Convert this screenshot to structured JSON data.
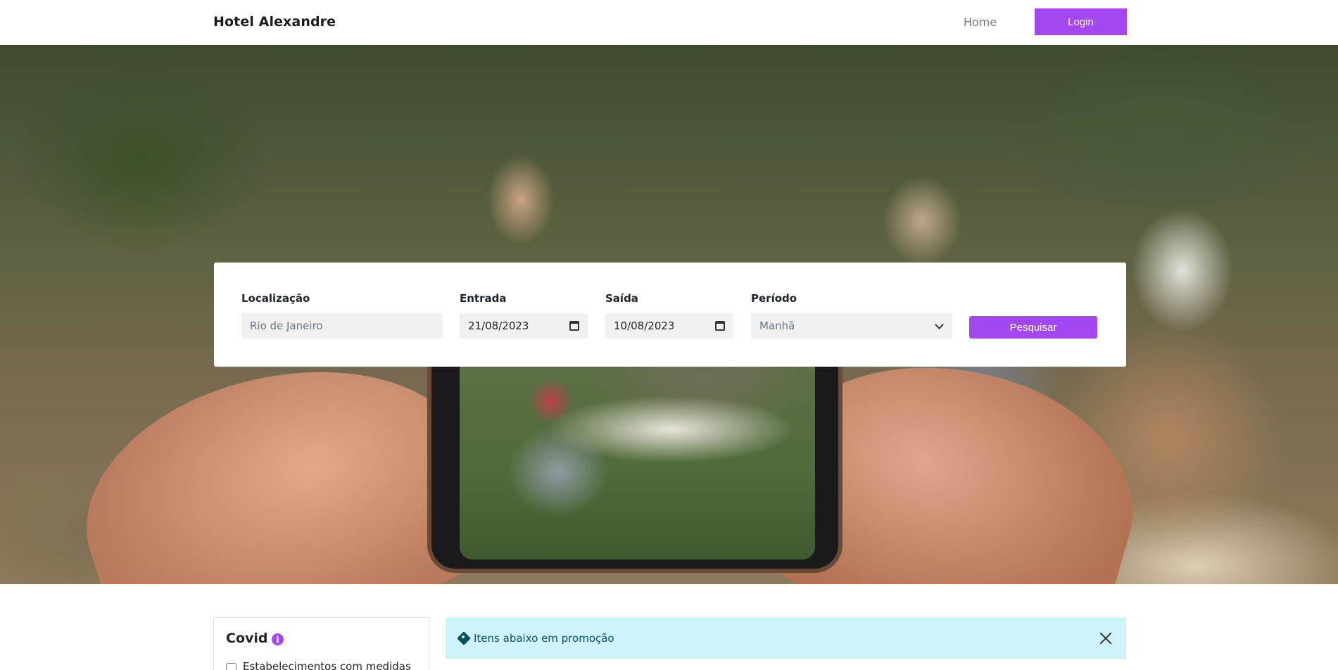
{
  "navbar": {
    "brand": "Hotel Alexandre",
    "home_label": "Home",
    "login_label": "Login"
  },
  "search": {
    "location": {
      "label": "Localização",
      "placeholder": "Rio de Janeiro"
    },
    "checkin": {
      "label": "Entrada",
      "value": "21/08/2023"
    },
    "checkout": {
      "label": "Saída",
      "value": "10/08/2023"
    },
    "period": {
      "label": "Período",
      "value": "Manhã"
    },
    "button_label": "Pesquisar"
  },
  "covid": {
    "title": "Covid",
    "info_icon": "info-icon",
    "checkbox_label": "Estabelecimentos com medidas"
  },
  "promo": {
    "text": "Itens abaixo em promoção"
  },
  "colors": {
    "accent": "#a347f0",
    "alert_bg": "#cff4fc",
    "alert_text": "#055160"
  }
}
